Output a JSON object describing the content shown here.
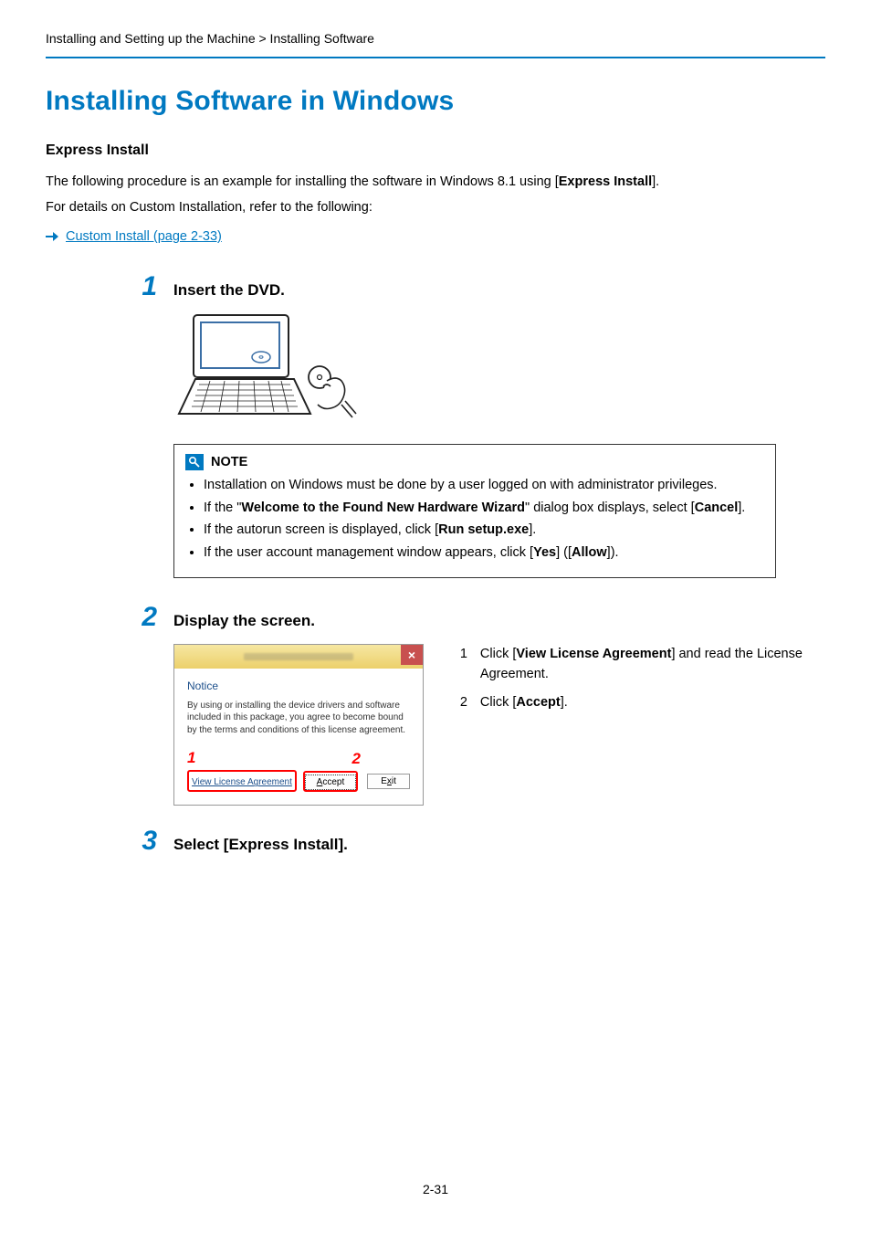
{
  "breadcrumb": "Installing and Setting up the Machine > Installing Software",
  "heading": "Installing Software in Windows",
  "subheading": "Express Install",
  "intro1_pre": "The following procedure is an example for installing the software in Windows 8.1 using [",
  "intro1_bold": "Express Install",
  "intro1_post": "].",
  "intro2": "For details on Custom Installation, refer to the following:",
  "link_text": "Custom Install (page 2-33)",
  "step1": {
    "num": "1",
    "title": "Insert the DVD."
  },
  "note": {
    "title": "NOTE",
    "items": {
      "a": "Installation on Windows must be done by a user logged on with administrator privileges.",
      "b_pre": "If the \"",
      "b_bold1": "Welcome to the Found New Hardware Wizard",
      "b_mid": "\" dialog box displays, select [",
      "b_bold2": "Cancel",
      "b_post": "].",
      "c_pre": "If the autorun screen is displayed, click [",
      "c_bold": "Run setup.exe",
      "c_post": "].",
      "d_pre": "If the user account management window appears, click [",
      "d_bold1": "Yes",
      "d_mid": "] ([",
      "d_bold2": "Allow",
      "d_post": "])."
    }
  },
  "step2": {
    "num": "2",
    "title": "Display the screen.",
    "dialog": {
      "notice_label": "Notice",
      "notice_text": "By using or installing the device drivers and software included in this package, you agree to become bound by the terms and conditions of this license agreement.",
      "callout1": "1",
      "callout2": "2",
      "vla": "View License Agreement",
      "accept": "Accept",
      "exit": "Exit",
      "close": "×"
    },
    "side": {
      "n1": "1",
      "t1_pre": "Click [",
      "t1_bold": "View License Agreement",
      "t1_post": "] and read the License Agreement.",
      "n2": "2",
      "t2_pre": "Click [",
      "t2_bold": "Accept",
      "t2_post": "]."
    }
  },
  "step3": {
    "num": "3",
    "title": "Select [Express Install]."
  },
  "page_number": "2-31"
}
